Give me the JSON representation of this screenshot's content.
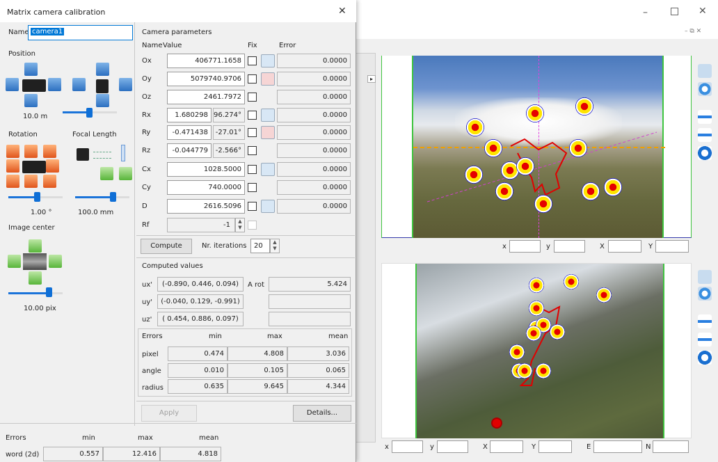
{
  "dialog": {
    "title": "Matrix camera calibration",
    "name_label": "Name",
    "name_value": "camera1",
    "position_label": "Position",
    "position_value": "10.0  m",
    "rotation_label": "Rotation",
    "focal_label": "Focal Length",
    "rotation_value": "1.00 °",
    "focal_value": "100.0  mm",
    "image_center_label": "Image center",
    "image_center_value": "10.00  pix",
    "camera_params_label": "Camera parameters",
    "col_name": "Name",
    "col_value": "Value",
    "col_fix": "Fix",
    "col_error": "Error",
    "params": [
      {
        "name": "Ox",
        "value": "406771.1658",
        "error": "0.0000"
      },
      {
        "name": "Oy",
        "value": "5079740.9706",
        "error": "0.0000"
      },
      {
        "name": "Oz",
        "value": "2461.7972",
        "error": "0.0000"
      },
      {
        "name": "Rx",
        "value": "1.680298",
        "deg": "96.274°",
        "error": "0.0000"
      },
      {
        "name": "Ry",
        "value": "-0.471438",
        "deg": "-27.01°",
        "error": "0.0000"
      },
      {
        "name": "Rz",
        "value": "-0.044779",
        "deg": "-2.566°",
        "error": "0.0000"
      },
      {
        "name": "Cx",
        "value": "1028.5000",
        "error": "0.0000"
      },
      {
        "name": "Cy",
        "value": "740.0000",
        "error": "0.0000"
      },
      {
        "name": "D",
        "value": "2616.5096",
        "error": "0.0000"
      },
      {
        "name": "Rf",
        "value": "-1"
      }
    ],
    "compute_label": "Compute",
    "iterations_label": "Nr. iterations",
    "iterations_value": "20",
    "computed_label": "Computed values",
    "ux_label": "ux'",
    "ux_value": "(-0.890, 0.446, 0.094)",
    "uy_label": "uy'",
    "uy_value": "(-0.040, 0.129, -0.991)",
    "uz_label": "uz'",
    "uz_value": "( 0.454, 0.886, 0.097)",
    "arot_label": "A rot",
    "arot_value": "5.424",
    "errors": {
      "label": "Errors",
      "h_min": "min",
      "h_max": "max",
      "h_mean": "mean",
      "rows": [
        {
          "name": "pixel",
          "min": "0.474",
          "max": "4.808",
          "mean": "3.036"
        },
        {
          "name": "angle",
          "min": "0.010",
          "max": "0.105",
          "mean": "0.065"
        },
        {
          "name": "radius",
          "min": "0.635",
          "max": "9.645",
          "mean": "4.344"
        }
      ]
    },
    "apply_label": "Apply",
    "details_label": "Details...",
    "bottom_errors": {
      "label": "Errors",
      "h_min": "min",
      "h_max": "max",
      "h_mean": "mean",
      "row_name": "word (2d)",
      "min": "0.557",
      "max": "12.416",
      "mean": "4.818"
    }
  },
  "coord_top": {
    "x": "x",
    "y": "y",
    "X": "X",
    "Y": "Y"
  },
  "coord_bottom": {
    "x": "x",
    "y": "y",
    "X": "X",
    "Y": "Y",
    "E": "E",
    "N": "N"
  },
  "colors": {
    "accent": "#0f6fd6",
    "selection": "#0078d7",
    "frame_green": "#3fc43f"
  }
}
